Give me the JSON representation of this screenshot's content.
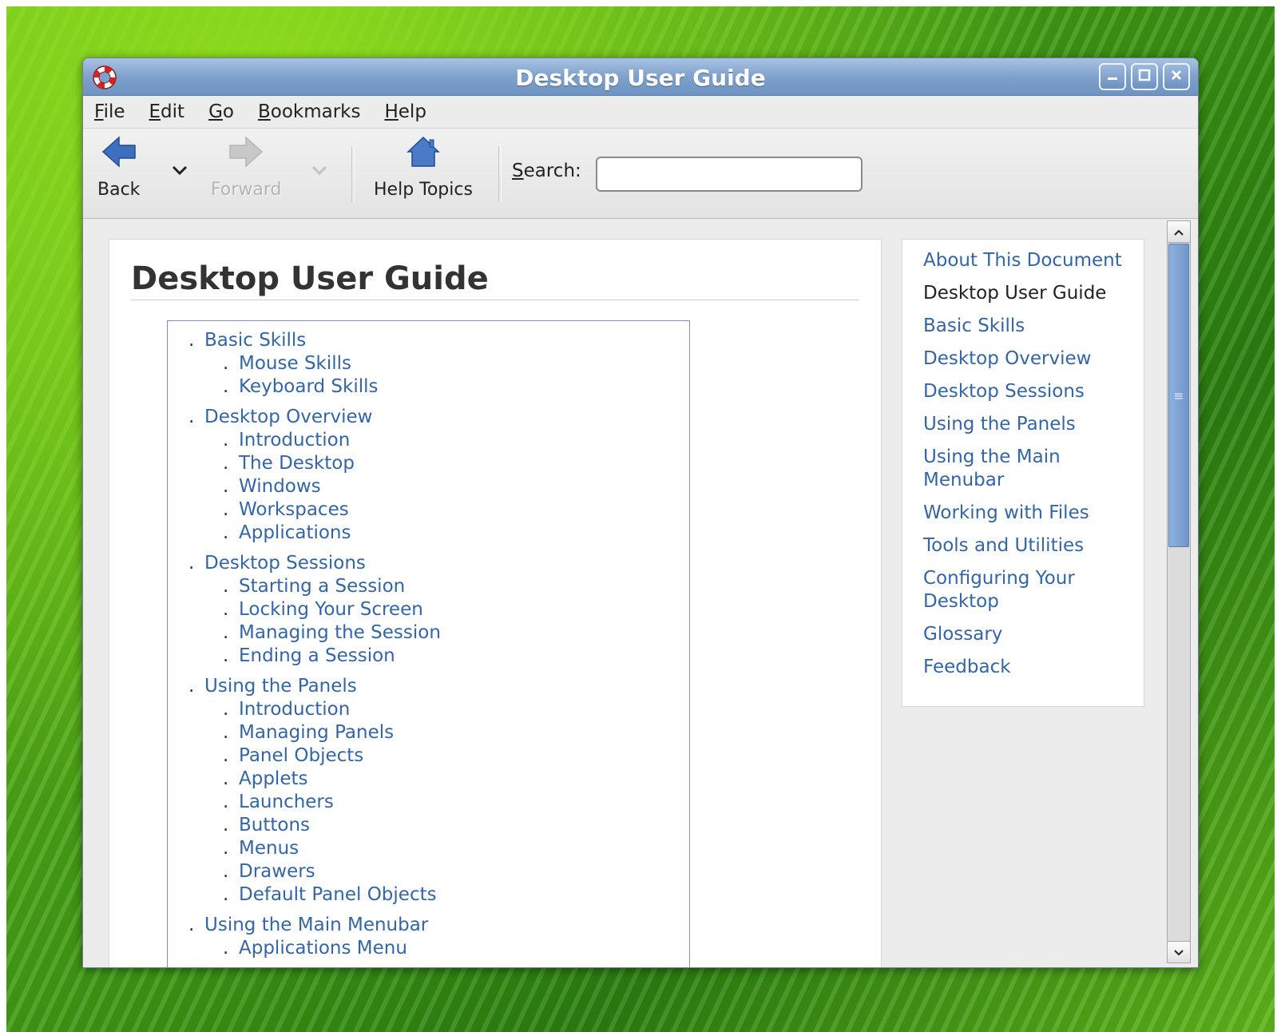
{
  "window": {
    "title": "Desktop User Guide"
  },
  "menubar": {
    "items": [
      {
        "label": "File"
      },
      {
        "label": "Edit"
      },
      {
        "label": "Go"
      },
      {
        "label": "Bookmarks"
      },
      {
        "label": "Help"
      }
    ]
  },
  "toolbar": {
    "back_label": "Back",
    "forward_label": "Forward",
    "help_topics_label": "Help Topics",
    "search_label": "Search:",
    "search_value": ""
  },
  "page": {
    "title": "Desktop User Guide",
    "toc": [
      {
        "label": "Basic Skills",
        "children": [
          "Mouse Skills",
          "Keyboard Skills"
        ]
      },
      {
        "label": "Desktop Overview",
        "children": [
          "Introduction",
          "The Desktop",
          "Windows",
          "Workspaces",
          "Applications"
        ]
      },
      {
        "label": "Desktop Sessions",
        "children": [
          "Starting a Session",
          "Locking Your Screen",
          "Managing the Session",
          "Ending a Session"
        ]
      },
      {
        "label": "Using the Panels",
        "children": [
          "Introduction",
          "Managing Panels",
          "Panel Objects",
          "Applets",
          "Launchers",
          "Buttons",
          "Menus",
          "Drawers",
          "Default Panel Objects"
        ]
      },
      {
        "label": "Using the Main Menubar",
        "children": [
          "Applications Menu"
        ]
      }
    ]
  },
  "sidebar": {
    "items": [
      {
        "label": "About This Document",
        "current": false
      },
      {
        "label": "Desktop User Guide",
        "current": true
      },
      {
        "label": "Basic Skills",
        "current": false
      },
      {
        "label": "Desktop Overview",
        "current": false
      },
      {
        "label": "Desktop Sessions",
        "current": false
      },
      {
        "label": "Using the Panels",
        "current": false
      },
      {
        "label": "Using the Main Menubar",
        "current": false
      },
      {
        "label": "Working with Files",
        "current": false
      },
      {
        "label": "Tools and Utilities",
        "current": false
      },
      {
        "label": "Configuring Your Desktop",
        "current": false
      },
      {
        "label": "Glossary",
        "current": false
      },
      {
        "label": "Feedback",
        "current": false
      }
    ]
  },
  "colors": {
    "link": "#3465a4",
    "titlebar": "#7ea1cc",
    "desktop_green": "#3f9a14"
  },
  "icons": [
    "help-lifebuoy-icon",
    "minimize-icon",
    "maximize-icon",
    "close-icon",
    "back-arrow-icon",
    "forward-arrow-icon",
    "home-icon",
    "chevron-down-icon",
    "scroll-up-icon",
    "scroll-down-icon"
  ]
}
